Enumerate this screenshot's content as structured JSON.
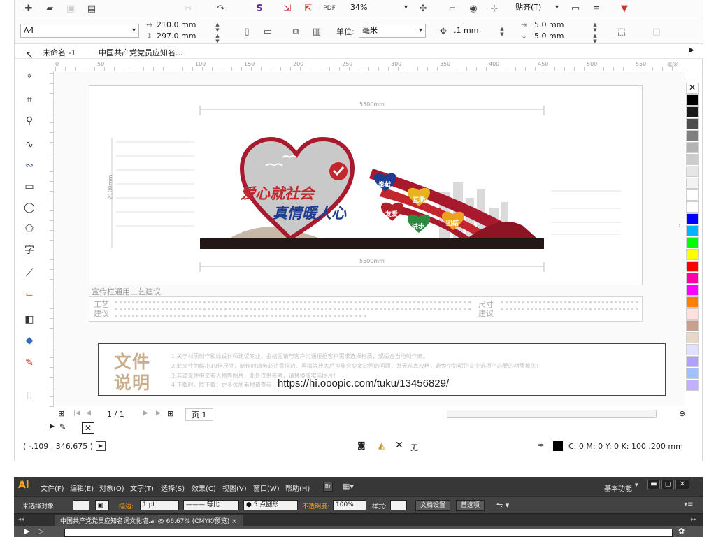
{
  "colors": {
    "brand_red": "#a8192e",
    "heart_red": "#c1272d",
    "ground_black": "#231815",
    "gold_text": "#c9ad8c"
  },
  "corel": {
    "toolbar": {
      "zoom": "34%",
      "snap": "贴齐(T)"
    },
    "property_bar": {
      "paper": "A4",
      "width": "210.0 mm",
      "height": "297.0 mm",
      "units_label": "单位:",
      "units": "毫米",
      "nudge": ".1 mm",
      "dup_x": "5.0 mm",
      "dup_y": "5.0 mm"
    },
    "doc_tabs": [
      "未命名 -1",
      "中国共产党党员应知名..."
    ],
    "ruler_ticks": [
      "0",
      "50",
      "100",
      "150",
      "200",
      "250",
      "300",
      "350",
      "400",
      "450",
      "500",
      "550",
      "毫米"
    ],
    "page_nav": {
      "count": "1 / 1",
      "page_label": "页 1"
    },
    "status": {
      "coords": "( -.109 , 346.675 )",
      "fill_label": "无",
      "outline": "C: 0 M: 0 Y: 0 K: 100  .200 mm"
    }
  },
  "board": {
    "dimension_top": "5500mm",
    "dimension_bottom": "5500mm",
    "dimension_side": "2100mm",
    "slogan_line1": "爱心就社会",
    "slogan_line2": "真情暖人心",
    "hearts": [
      "奉献",
      "互助",
      "友爱",
      "进步",
      "团结"
    ],
    "notes_title": "宣传栏通用工艺建议",
    "notes_left_label": "工艺建议",
    "notes_right_label": "尺寸建议",
    "desc_title_1": "文件",
    "desc_title_2": "说明",
    "desc_lines": [
      "1.关于材质制作和比设计师建议专业，金格图请与客户沟通根据客户需求选择材质，或适合当地制作商。",
      "2.此文件为缩小10倍尺寸，制作时请务必注意描边、黑稿等放大后可能会变宽比例的问题，并无从真权格，避免个别明别文字选项不必要的材质损失！",
      "3.若道文件中文有人物等图片，此处仅供参考，请替换成实际图片！",
      "4.下载时，除下载：更多优质素材请查看"
    ],
    "url": "https://hi.ooopic.com/tuku/13456829/"
  },
  "palette": [
    "#ffffff",
    "#000000",
    "#1a1a1a",
    "#4d4d4d",
    "#7f7f7f",
    "#b3b3b3",
    "#cccccc",
    "#e6e6e6",
    "#f2f2f2",
    "#ffffff",
    "#ffffff",
    "#0000ff",
    "#00b4ff",
    "#00ff00",
    "#ffff00",
    "#ff0000",
    "#ff00aa",
    "#ff00ff",
    "#ff7f00",
    "#ffe0e0",
    "#c8a090",
    "#e8d8c8",
    "#e0e0ff",
    "#b0a0ff",
    "#a0c0ff",
    "#c0b0ff"
  ],
  "ai": {
    "logo": "Ai",
    "menu": [
      "文件(F)",
      "编辑(E)",
      "对象(O)",
      "文字(T)",
      "选择(S)",
      "效果(C)",
      "视图(V)",
      "窗口(W)",
      "帮助(H)"
    ],
    "workspace": "基本功能",
    "control": {
      "no_selection": "未选择对象",
      "stroke_label": "描边:",
      "stroke_value": "1 pt",
      "stroke_style": "等比",
      "brush": "5 点圆形",
      "opacity_label": "不透明度:",
      "opacity": "100%",
      "style_label": "样式:",
      "doc_setup": "文档设置",
      "prefs": "首选项"
    },
    "doc_tab": "中国共产党党员应知名词文化墙.ai @ 66.67% (CMYK/预览)",
    "doc_tab_close": "×"
  }
}
